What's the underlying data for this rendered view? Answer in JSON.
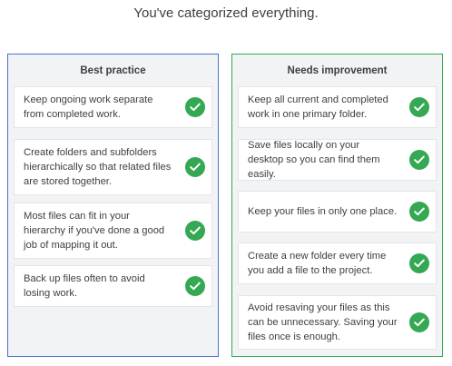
{
  "headline": "You've categorized everything.",
  "colors": {
    "best_border": "#4a72cf",
    "improve_border": "#34a853",
    "check": "#34a853",
    "panel_bg": "#f1f3f4"
  },
  "columns": [
    {
      "title": "Best practice",
      "items": [
        {
          "text": "Keep ongoing work separate from completed work.",
          "icon": "check-circle-icon"
        },
        {
          "text": "Create folders and subfolders hierarchically so that related files are stored together.",
          "icon": "check-circle-icon"
        },
        {
          "text": "Most files can fit in your hierarchy if you've done a good job of mapping it out.",
          "icon": "check-circle-icon"
        },
        {
          "text": "Back up files often to avoid losing work.",
          "icon": "check-circle-icon"
        }
      ]
    },
    {
      "title": "Needs improvement",
      "items": [
        {
          "text": "Keep all current and completed work in one primary folder.",
          "icon": "check-circle-icon"
        },
        {
          "text": "Save files locally on your desktop so you can find them easily.",
          "icon": "check-circle-icon"
        },
        {
          "text": "Keep your files in only one place.",
          "icon": "check-circle-icon"
        },
        {
          "text": "Create a new folder every time you add a file to the project.",
          "icon": "check-circle-icon"
        },
        {
          "text": "Avoid resaving your files as this can be unnecessary. Saving your files once is enough.",
          "icon": "check-circle-icon"
        }
      ]
    }
  ]
}
